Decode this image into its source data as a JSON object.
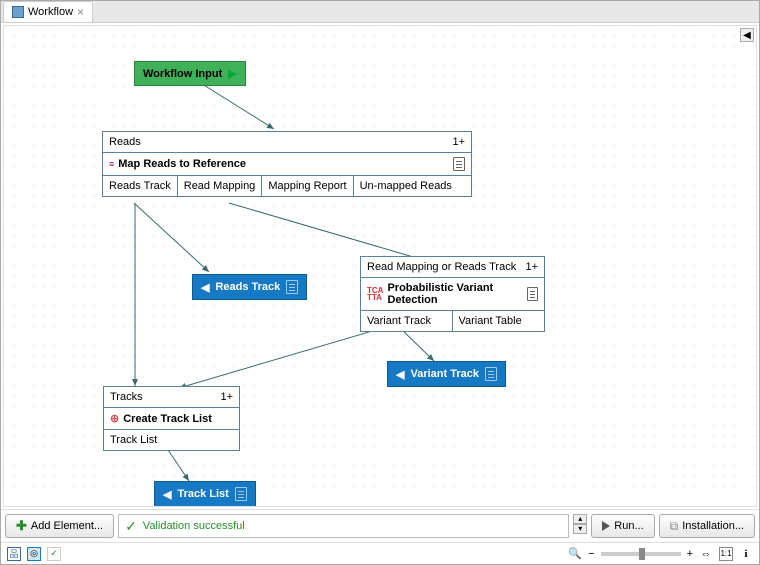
{
  "tab": {
    "title": "Workflow"
  },
  "nodes": {
    "input": {
      "label": "Workflow Input"
    },
    "reads": {
      "header": "Reads",
      "mult": "1+",
      "body": "Map Reads to Reference",
      "ports": [
        "Reads Track",
        "Read Mapping",
        "Mapping Report",
        "Un-mapped Reads"
      ]
    },
    "variant": {
      "header": "Read Mapping or Reads Track",
      "mult": "1+",
      "body": "Probabilistic Variant Detection",
      "ports": [
        "Variant Track",
        "Variant Table"
      ]
    },
    "tracks": {
      "header": "Tracks",
      "mult": "1+",
      "body": "Create Track List",
      "ports": [
        "Track List"
      ]
    },
    "out_reads": {
      "label": "Reads Track"
    },
    "out_variant": {
      "label": "Variant Track"
    },
    "out_tracklist": {
      "label": "Track List"
    }
  },
  "toolbar": {
    "add": "Add Element...",
    "status": "Validation successful",
    "run": "Run...",
    "install": "Installation..."
  }
}
